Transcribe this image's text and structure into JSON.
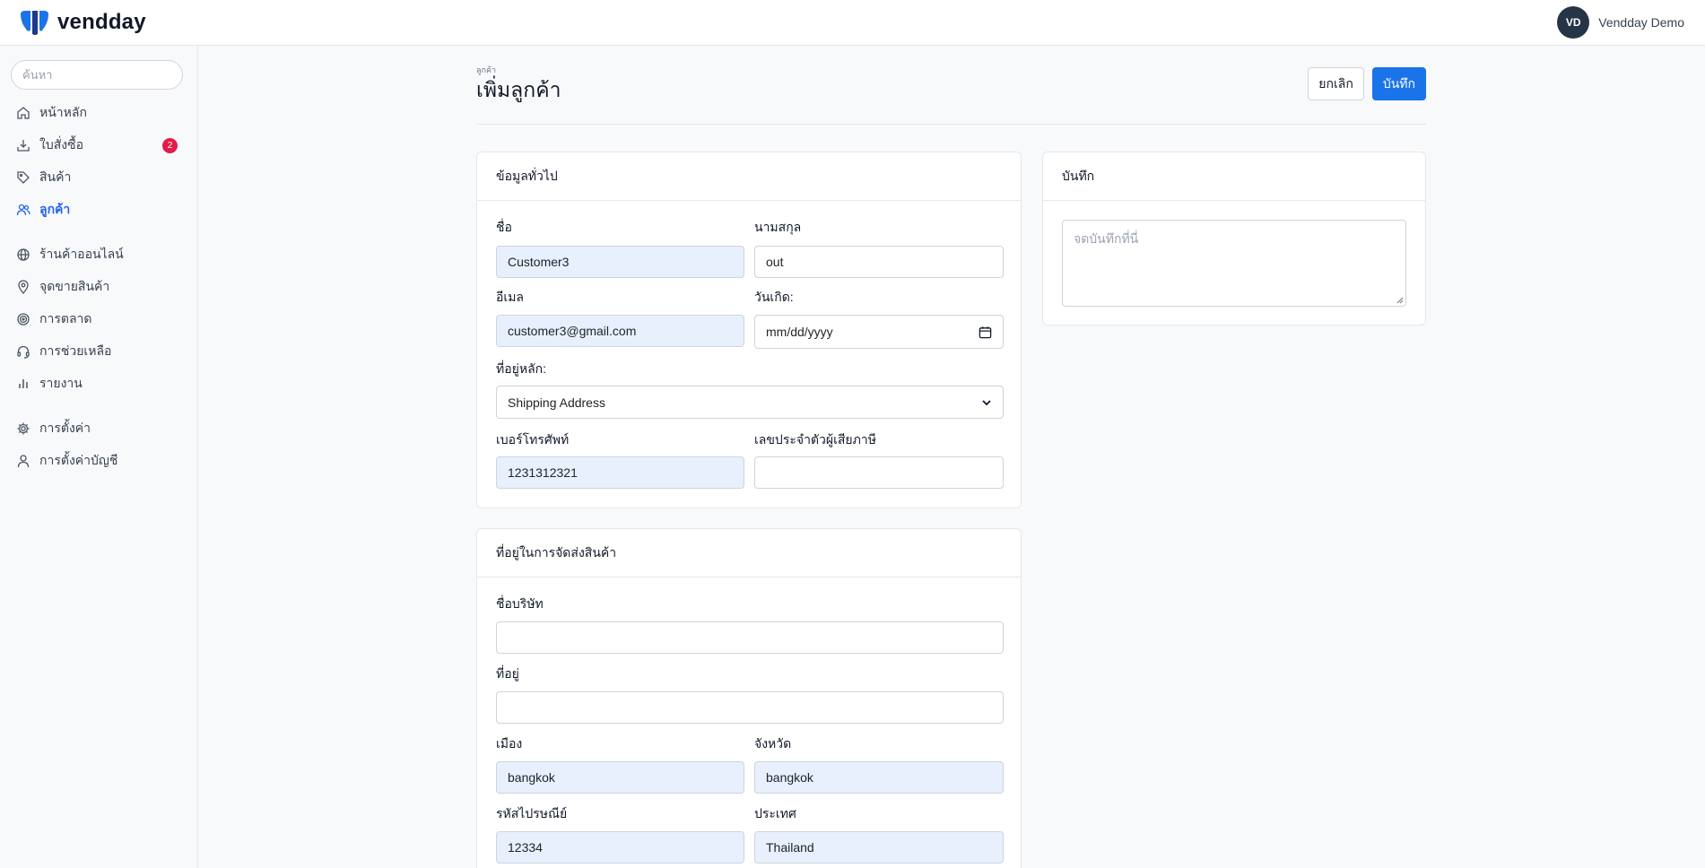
{
  "app": {
    "brand": "vendday",
    "user_initials": "VD",
    "user_name": "Vendday Demo"
  },
  "sidebar": {
    "search_placeholder": "ค้นหา",
    "items": [
      {
        "label": "หน้าหลัก"
      },
      {
        "label": "ใบสั่งซื้อ",
        "badge": "2"
      },
      {
        "label": "สินค้า"
      },
      {
        "label": "ลูกค้า"
      },
      {
        "label": "ร้านค้าออนไลน์"
      },
      {
        "label": "จุดขายสินค้า"
      },
      {
        "label": "การตลาด"
      },
      {
        "label": "การช่วยเหลือ"
      },
      {
        "label": "รายงาน"
      },
      {
        "label": "การตั้งค่า"
      },
      {
        "label": "การตั้งค่าบัญชี"
      }
    ]
  },
  "header": {
    "breadcrumb": "ลูกค้า",
    "title": "เพิ่มลูกค้า",
    "cancel": "ยกเลิก",
    "save": "บันทึก"
  },
  "general": {
    "title": "ข้อมูลทั่วไป",
    "first_name_label": "ชื่อ",
    "first_name": "Customer3",
    "last_name_label": "นามสกุล",
    "last_name": "out",
    "email_label": "อีเมล",
    "email": "customer3@gmail.com",
    "birthday_label": "วันเกิด:",
    "birthday_placeholder": "mm/dd/yyyy",
    "address_label": "ที่อยู่หลัก:",
    "address_selected": "Shipping Address",
    "phone_label": "เบอร์โทรศัพท์",
    "phone": "1231312321",
    "tax_label": "เลขประจำตัวผู้เสียภาษี",
    "tax": ""
  },
  "shipping": {
    "title": "ที่อยู่ในการจัดส่งสินค้า",
    "company_label": "ชื่อบริษัท",
    "company": "",
    "address_label": "ที่อยู่",
    "address": "",
    "city_label": "เมือง",
    "city": "bangkok",
    "province_label": "จังหวัด",
    "province": "bangkok",
    "postal_label": "รหัสไปรษณีย์",
    "postal": "12334",
    "country_label": "ประเทศ",
    "country": "Thailand"
  },
  "notes": {
    "title": "บันทึก",
    "placeholder": "จดบันทึกที่นี่"
  }
}
